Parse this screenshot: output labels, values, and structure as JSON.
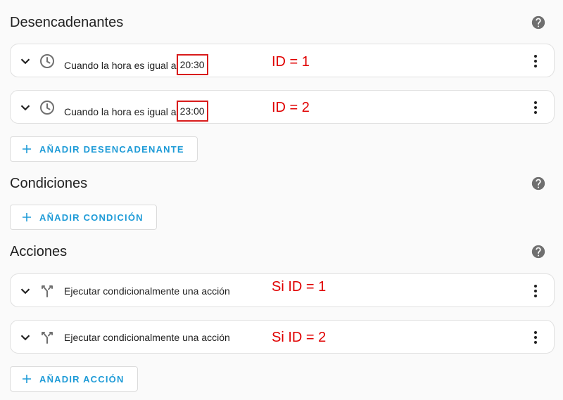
{
  "triggers": {
    "title": "Desencadenantes",
    "items": [
      {
        "text": "Cuando la hora es igual a",
        "time": "20:30",
        "annotation": "ID = 1"
      },
      {
        "text": "Cuando la hora es igual a",
        "time": "23:00",
        "annotation": "ID = 2"
      }
    ],
    "add_label": "AÑADIR DESENCADENANTE"
  },
  "conditions": {
    "title": "Condiciones",
    "add_label": "AÑADIR CONDICIÓN"
  },
  "actions": {
    "title": "Acciones",
    "items": [
      {
        "text": "Ejecutar condicionalmente una acción",
        "annotation": "Si ID = 1"
      },
      {
        "text": "Ejecutar condicionalmente una acción",
        "annotation": "Si ID = 2"
      }
    ],
    "add_label": "AÑADIR ACCIÓN"
  },
  "colors": {
    "accent": "#1e9bd7",
    "annotation": "#e00000",
    "icon": "#6f6f6f"
  }
}
